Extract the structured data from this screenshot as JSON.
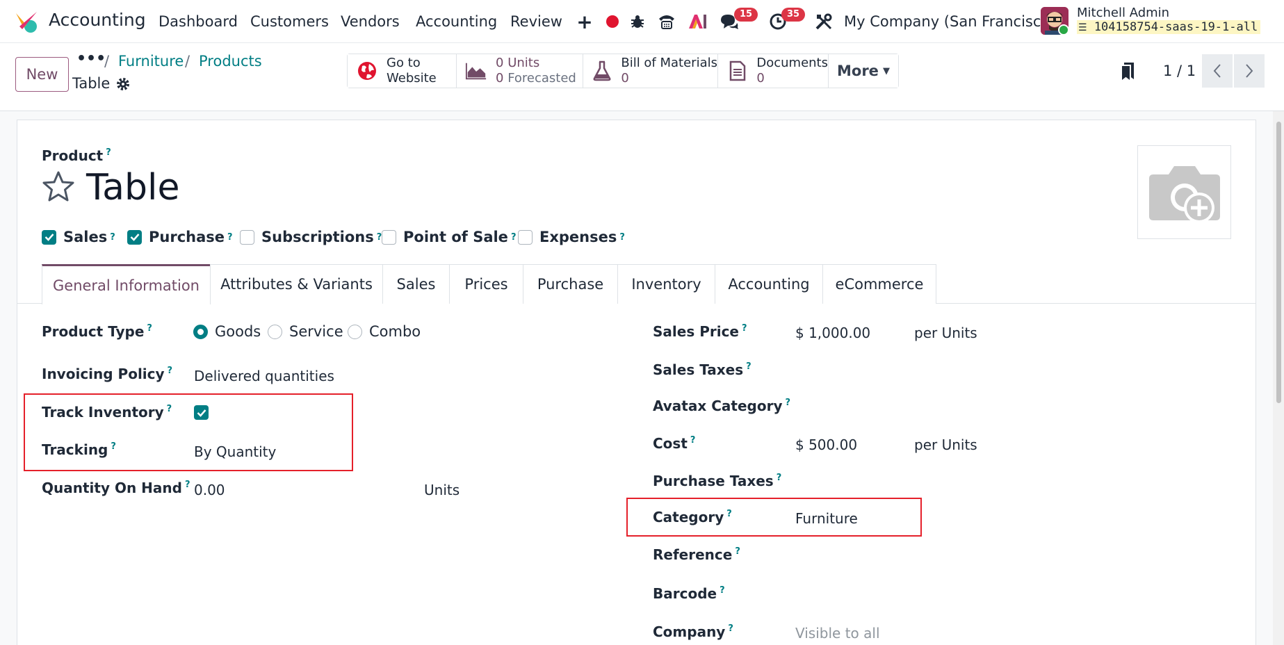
{
  "navbar": {
    "app_name": "Accounting",
    "menu": [
      "Dashboard",
      "Customers",
      "Vendors",
      "Accounting",
      "Review"
    ],
    "messages_badge": "15",
    "activities_badge": "35",
    "company": "My Company (San Francisco)",
    "user_name": "Mitchell Admin",
    "database": "104158754-saas-19-1-all"
  },
  "control": {
    "new_label": "New",
    "breadcrumb_dots": "•••",
    "breadcrumb": [
      "Furniture",
      "Products"
    ],
    "record_name": "Table",
    "smart_buttons": {
      "website_line1": "Go to",
      "website_line2": "Website",
      "units_num": "0",
      "units_label": "Units",
      "forecast_num": "0",
      "forecast_label": "Forecasted",
      "bom_label": "Bill of Materials",
      "bom_value": "0",
      "documents_label": "Documents",
      "documents_value": "0",
      "more_label": "More"
    },
    "pager": "1 / 1"
  },
  "form": {
    "product_label": "Product",
    "title": "Table",
    "checkboxes": [
      {
        "label": "Sales",
        "checked": true
      },
      {
        "label": "Purchase",
        "checked": true
      },
      {
        "label": "Subscriptions",
        "checked": false
      },
      {
        "label": "Point of Sale",
        "checked": false
      },
      {
        "label": "Expenses",
        "checked": false
      }
    ],
    "tabs": [
      "General Information",
      "Attributes & Variants",
      "Sales",
      "Prices",
      "Purchase",
      "Inventory",
      "Accounting",
      "eCommerce"
    ],
    "left": {
      "product_type_label": "Product Type",
      "product_type_options": [
        "Goods",
        "Service",
        "Combo"
      ],
      "product_type_selected": "Goods",
      "invoicing_policy_label": "Invoicing Policy",
      "invoicing_policy_value": "Delivered quantities",
      "track_inventory_label": "Track Inventory",
      "track_inventory_checked": true,
      "tracking_label": "Tracking",
      "tracking_value": "By Quantity",
      "qty_label": "Quantity On Hand",
      "qty_value": "0.00",
      "qty_unit": "Units"
    },
    "right": {
      "sales_price_label": "Sales Price",
      "sales_price_value": "$ 1,000.00",
      "sales_price_unit": "per Units",
      "sales_taxes_label": "Sales Taxes",
      "avatax_label": "Avatax Category",
      "cost_label": "Cost",
      "cost_value": "$ 500.00",
      "cost_unit": "per Units",
      "purchase_taxes_label": "Purchase Taxes",
      "category_label": "Category",
      "category_value": "Furniture",
      "reference_label": "Reference",
      "barcode_label": "Barcode",
      "company_label": "Company",
      "company_placeholder": "Visible to all"
    },
    "help_mark": "?"
  },
  "colors": {
    "brand": "#714b67",
    "link": "#017e84",
    "highlight": "#e5202a",
    "badge": "#dc3545"
  }
}
